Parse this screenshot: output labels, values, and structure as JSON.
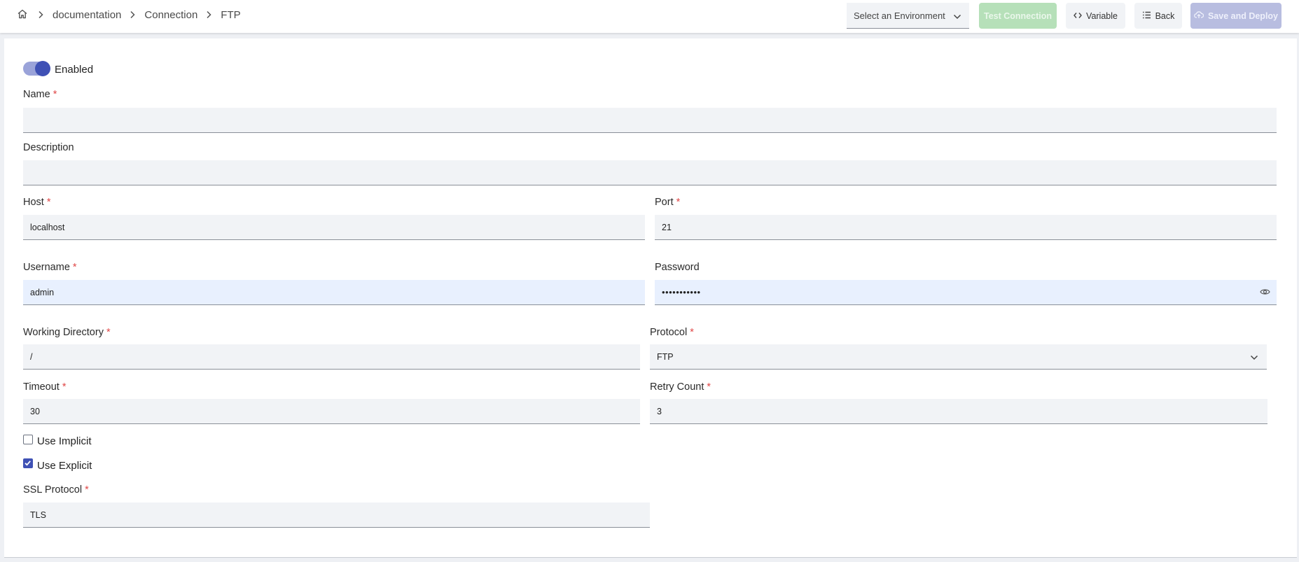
{
  "breadcrumb": {
    "items": [
      "documentation",
      "Connection",
      "FTP"
    ]
  },
  "toolbar": {
    "environment_placeholder": "Select an Environment",
    "test_connection_label": "Test Connection",
    "variable_label": "Variable",
    "back_label": "Back",
    "save_deploy_label": "Save and Deploy"
  },
  "form": {
    "enabled_label": "Enabled",
    "enabled": true,
    "name": {
      "label": "Name",
      "required_mark": "*",
      "value": ""
    },
    "description": {
      "label": "Description",
      "value": ""
    },
    "host": {
      "label": "Host",
      "required_mark": "*",
      "value": "localhost"
    },
    "port": {
      "label": "Port",
      "required_mark": "*",
      "value": "21"
    },
    "username": {
      "label": "Username",
      "required_mark": "*",
      "value": "admin"
    },
    "password": {
      "label": "Password",
      "value": "•••••••••••"
    },
    "working_directory": {
      "label": "Working Directory",
      "required_mark": "*",
      "value": "/"
    },
    "protocol": {
      "label": "Protocol",
      "required_mark": "*",
      "value": "FTP"
    },
    "timeout": {
      "label": "Timeout",
      "required_mark": "*",
      "value": "30"
    },
    "retry_count": {
      "label": "Retry Count",
      "required_mark": "*",
      "value": "3"
    },
    "use_implicit": {
      "label": "Use Implicit",
      "checked": false
    },
    "use_explicit": {
      "label": "Use Explicit",
      "checked": true
    },
    "ssl_protocol": {
      "label": "SSL Protocol",
      "required_mark": "*",
      "value": "TLS"
    }
  },
  "colors": {
    "accent": "#3f51b5",
    "test_button": "#b6e0b9",
    "save_button": "#b8bde0",
    "required": "#e04848"
  },
  "icons": [
    "home-icon",
    "chevron-right-icon",
    "chevron-down-icon",
    "code-icon",
    "list-icon",
    "cloud-upload-icon",
    "eye-icon",
    "check-icon"
  ]
}
